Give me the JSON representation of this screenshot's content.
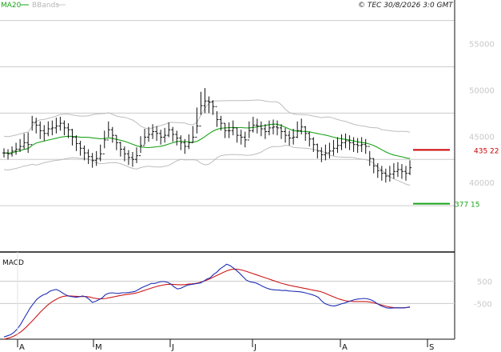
{
  "header": {
    "legend": [
      {
        "label": "MA20",
        "color": "#19a319"
      },
      {
        "label": "BBands",
        "color": "#b5b5b5"
      }
    ],
    "watermark": "© TEC 30/8/2026 3:0 GMT"
  },
  "colors": {
    "bars": "#111111",
    "ma20": "#19a319",
    "bbands": "#bdbdbd",
    "grid": "#cccccc",
    "resistance": "#cc0000",
    "support": "#19a319",
    "macd": "#1f2fb5",
    "signal": "#cc1a1a"
  },
  "chart_data": [
    {
      "type": "ohlc",
      "panel": "price",
      "x_tick_labels": [
        "A",
        "M",
        "J",
        "J",
        "A",
        "S"
      ],
      "y_tick_labels": [
        "55000",
        "50000",
        "45000",
        "40000"
      ],
      "y_ticks": [
        55000,
        50000,
        45000,
        40000
      ],
      "ylim": [
        32500,
        58500
      ],
      "grid": true,
      "levels": [
        {
          "name": "resistance",
          "value": 43522,
          "label": "435 22",
          "color": "#cc0000"
        },
        {
          "name": "support",
          "value": 37715,
          "label": "377 15",
          "color": "#19a319"
        }
      ],
      "close": [
        43200,
        43100,
        43400,
        43600,
        43900,
        44300,
        44100,
        46500,
        46200,
        45600,
        45300,
        45800,
        45900,
        46100,
        46400,
        45900,
        45700,
        44900,
        44200,
        43700,
        43200,
        42800,
        42400,
        42600,
        43100,
        44600,
        45700,
        45100,
        44300,
        43600,
        43100,
        42700,
        42500,
        42900,
        44000,
        44900,
        45200,
        45500,
        45300,
        44900,
        45100,
        45700,
        45200,
        44800,
        44300,
        43900,
        44300,
        44900,
        46100,
        48300,
        48800,
        48700,
        48200,
        46800,
        46400,
        45600,
        45600,
        45900,
        45100,
        44900,
        44600,
        45600,
        46200,
        46100,
        45800,
        45500,
        45900,
        46000,
        45900,
        45500,
        45100,
        44800,
        44900,
        45600,
        46000,
        45300,
        44700,
        44100,
        43400,
        43000,
        43200,
        43400,
        43700,
        44000,
        44300,
        44500,
        44300,
        44100,
        44000,
        44100,
        43900,
        42600,
        41800,
        41300,
        41000,
        40700,
        40900,
        41200,
        41400,
        41200,
        41000,
        41600
      ],
      "high": [
        43700,
        43600,
        43900,
        44300,
        44700,
        45300,
        45400,
        47200,
        47000,
        46600,
        46200,
        46600,
        46700,
        47000,
        47100,
        46700,
        46400,
        45800,
        45100,
        44500,
        44000,
        43600,
        43200,
        43400,
        44100,
        45600,
        46600,
        46000,
        45100,
        44400,
        43900,
        43500,
        43300,
        43800,
        45000,
        45800,
        46000,
        46300,
        46100,
        45700,
        45900,
        46500,
        46000,
        45600,
        45100,
        44700,
        45200,
        46100,
        48100,
        49800,
        50200,
        49300,
        48900,
        47700,
        47200,
        46400,
        46500,
        46700,
        45900,
        45700,
        45500,
        46600,
        47100,
        46900,
        46600,
        46300,
        46700,
        46800,
        46700,
        46300,
        45900,
        45600,
        45800,
        46600,
        46900,
        46100,
        45500,
        44900,
        44200,
        43800,
        44100,
        44300,
        44600,
        44900,
        45200,
        45300,
        45100,
        44900,
        44800,
        44900,
        44700,
        43400,
        42600,
        42100,
        41800,
        41500,
        41800,
        42100,
        42200,
        42000,
        41800,
        42400
      ],
      "low": [
        42700,
        42500,
        42800,
        43000,
        43300,
        43600,
        43200,
        45600,
        45300,
        44700,
        44500,
        45000,
        45100,
        45300,
        45600,
        45100,
        44800,
        44000,
        43400,
        42900,
        42400,
        42000,
        41600,
        41800,
        42300,
        43700,
        44900,
        44300,
        43500,
        42800,
        42300,
        41900,
        41700,
        42100,
        43200,
        44100,
        44400,
        44700,
        44500,
        44100,
        44300,
        44900,
        44400,
        44000,
        43500,
        43100,
        43600,
        44300,
        45300,
        47300,
        47500,
        47500,
        47300,
        46000,
        45600,
        44800,
        44800,
        45100,
        44300,
        44100,
        43800,
        44800,
        45400,
        45300,
        45000,
        44700,
        45100,
        45200,
        45100,
        44700,
        44300,
        44000,
        44100,
        44800,
        45200,
        44500,
        43900,
        43300,
        42600,
        42200,
        42400,
        42600,
        42900,
        43200,
        43500,
        43700,
        43500,
        43300,
        43200,
        43300,
        43100,
        41800,
        41000,
        40500,
        40200,
        40000,
        40100,
        40400,
        40600,
        40400,
        40200,
        40800
      ]
    },
    {
      "type": "line",
      "panel": "macd",
      "title": "MACD",
      "y_tick_labels": [
        "500",
        "-500"
      ],
      "y_ticks": [
        500,
        -500
      ],
      "ylim": [
        -2100,
        1700
      ],
      "grid": true,
      "series": [
        {
          "name": "macd",
          "values": [
            -2000,
            -1950,
            -1900,
            -1800,
            -1650,
            -1450,
            -1200,
            -950,
            -700,
            -500,
            -320,
            -200,
            -110,
            -60,
            50,
            100,
            130,
            60,
            -40,
            -120,
            -180,
            -200,
            -220,
            -200,
            -160,
            -200,
            -310,
            -450,
            -400,
            -330,
            -250,
            -100,
            -40,
            -20,
            -40,
            -50,
            -20,
            -20,
            -10,
            10,
            40,
            120,
            200,
            270,
            330,
            400,
            400,
            440,
            480,
            480,
            450,
            370,
            240,
            150,
            180,
            250,
            320,
            350,
            370,
            400,
            420,
            500,
            600,
            650,
            800,
            900,
            1050,
            1150,
            1260,
            1200,
            1100,
            980,
            850,
            700,
            550,
            480,
            450,
            420,
            350,
            270,
            200,
            150,
            120,
            110,
            100,
            80,
            90,
            60,
            50,
            40,
            30,
            10,
            -20,
            -60,
            -100,
            -150,
            -220,
            -380,
            -500,
            -560,
            -600,
            -610,
            -570,
            -520,
            -480,
            -430,
            -380,
            -330,
            -300,
            -290,
            -270,
            -290,
            -330,
            -400,
            -500,
            -590,
            -650,
            -700,
            -710,
            -700,
            -690,
            -700,
            -700,
            -680,
            -650
          ],
          "color": "#1f2fb5"
        },
        {
          "name": "signal",
          "values": [
            -2100,
            -2060,
            -2020,
            -1960,
            -1880,
            -1780,
            -1660,
            -1520,
            -1370,
            -1210,
            -1050,
            -890,
            -740,
            -600,
            -480,
            -380,
            -300,
            -230,
            -180,
            -160,
            -160,
            -170,
            -180,
            -190,
            -190,
            -190,
            -210,
            -250,
            -280,
            -290,
            -290,
            -270,
            -240,
            -210,
            -180,
            -150,
            -120,
            -100,
            -80,
            -60,
            -30,
            10,
            60,
            110,
            160,
            210,
            250,
            290,
            320,
            350,
            360,
            360,
            350,
            340,
            340,
            350,
            370,
            380,
            400,
            430,
            470,
            520,
            580,
            650,
            720,
            790,
            860,
            930,
            990,
            1030,
            1040,
            1030,
            1000,
            960,
            910,
            860,
            810,
            760,
            710,
            660,
            610,
            560,
            510,
            460,
            410,
            370,
            330,
            300,
            270,
            240,
            210,
            180,
            150,
            120,
            90,
            60,
            30,
            -20,
            -80,
            -150,
            -210,
            -270,
            -320,
            -360,
            -390,
            -400,
            -410,
            -410,
            -410,
            -410,
            -420,
            -440,
            -470,
            -510,
            -550,
            -590,
            -630,
            -660,
            -680,
            -690,
            -690,
            -690,
            -680,
            -670
          ],
          "color": "#cc1a1a"
        }
      ]
    }
  ]
}
